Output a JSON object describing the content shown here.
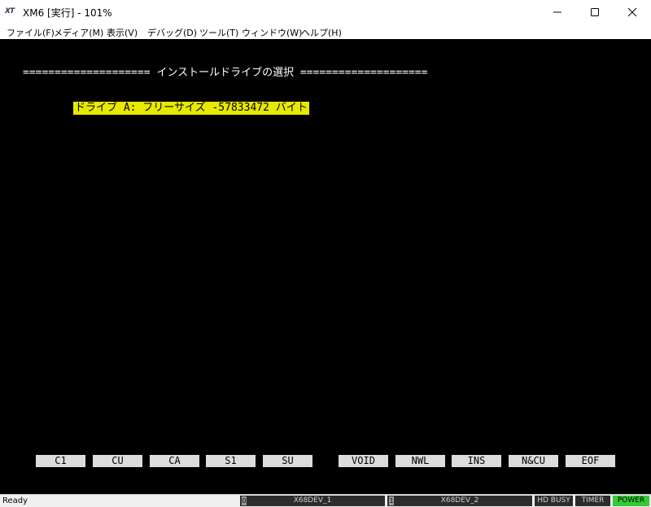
{
  "window": {
    "title": "XM6 [実行] - 101%",
    "icon_name": "xm6-logo-icon",
    "icon_text": "XT"
  },
  "menu": [
    "ファイル(F)",
    "メディア(M)",
    "表示(V)",
    "デバッグ(D)",
    "ツール(T)",
    "ウィンドウ(W)",
    "ヘルプ(H)"
  ],
  "screen": {
    "heading": "==================== インストールドライブの選択 ====================",
    "drive_line": "ドライブ A: フリーサイズ -57833472 バイト",
    "highlight_color": "#e8e800",
    "function_keys": [
      "C1",
      "CU",
      "CA",
      "S1",
      "SU",
      "VOID",
      "NWL",
      "INS",
      "N&CU",
      "EOF"
    ]
  },
  "status": {
    "ready": "Ready",
    "devices": [
      {
        "num": "0",
        "label": "X68DEV_1"
      },
      {
        "num": "1",
        "label": "X68DEV_2"
      }
    ],
    "indicators": [
      {
        "label": "HD BUSY",
        "bg": "#2c2c2c",
        "fg": "#d0d0d0"
      },
      {
        "label": "TIMER",
        "bg": "#2c2c2c",
        "fg": "#d0d0d0"
      },
      {
        "label": "POWER",
        "bg": "#33cc33",
        "fg": "#000000"
      }
    ]
  }
}
